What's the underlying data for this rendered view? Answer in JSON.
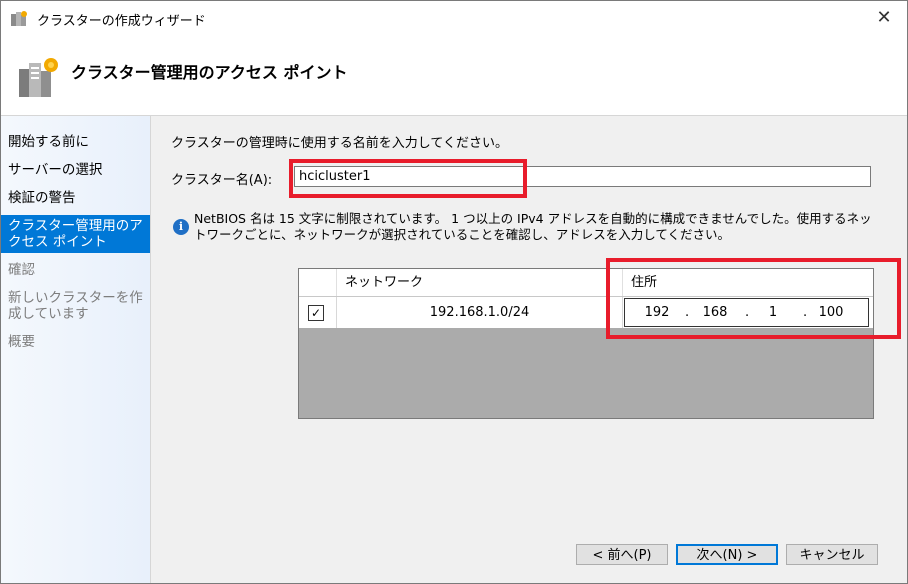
{
  "window": {
    "title": "クラスターの作成ウィザード",
    "close_glyph": "✕"
  },
  "header": {
    "title": "クラスター管理用のアクセス ポイント"
  },
  "sidebar": {
    "items": [
      {
        "label": "開始する前に",
        "state": "done"
      },
      {
        "label": "サーバーの選択",
        "state": "done"
      },
      {
        "label": "検証の警告",
        "state": "done"
      },
      {
        "label": "クラスター管理用のアクセス ポイント",
        "state": "current"
      },
      {
        "label": "確認",
        "state": "todo"
      },
      {
        "label": "新しいクラスターを作成しています",
        "state": "todo"
      },
      {
        "label": "概要",
        "state": "todo"
      }
    ]
  },
  "main": {
    "instruction": "クラスターの管理時に使用する名前を入力してください。",
    "cluster_name_label": "クラスター名(A):",
    "cluster_name_value": "hcicluster1",
    "info_icon_glyph": "i",
    "info_text": "NetBIOS 名は 15 文字に制限されています。 1 つ以上の IPv4 アドレスを自動的に構成できませんでした。使用するネットワークごとに、ネットワークが選択されていることを確認し、アドレスを入力してください。",
    "grid": {
      "headers": [
        "",
        "ネットワーク",
        "住所"
      ],
      "rows": [
        {
          "checked": true,
          "check_glyph": "✓",
          "network": "192.168.1.0/24",
          "address": [
            "192",
            "168",
            "1",
            "100"
          ]
        }
      ]
    }
  },
  "buttons": {
    "back": "< 前へ(P)",
    "next": "次へ(N) >",
    "cancel": "キャンセル"
  },
  "colors": {
    "accent": "#0078d7",
    "highlight": "#e81c2b",
    "grid_empty": "#ababab",
    "panel_bg": "#f0f0f0"
  }
}
